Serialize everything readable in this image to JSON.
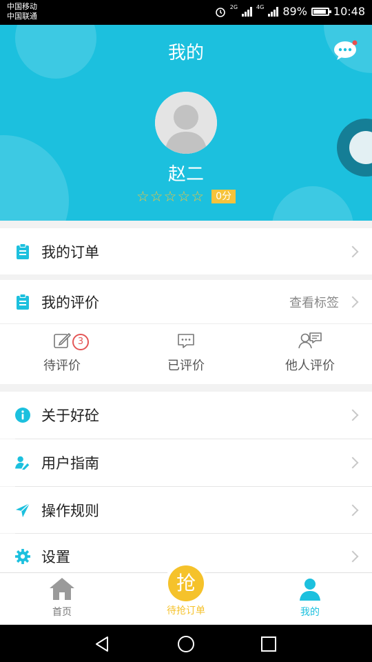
{
  "statusbar": {
    "carrier_1": "中国移动",
    "carrier_2": "中国联通",
    "net_1": "2G",
    "net_2": "4G",
    "battery_percent": "89%",
    "battery_level": 0.89,
    "time": "10:48"
  },
  "header": {
    "title": "我的",
    "user_name": "赵二",
    "rating_stars_total": 5,
    "rating_stars_filled": 0,
    "score_badge": "0分"
  },
  "menu": {
    "orders": "我的订单",
    "reviews": "我的评价",
    "reviews_right": "查看标签",
    "about": "关于好砼",
    "guide": "用户指南",
    "rules": "操作规则",
    "settings": "设置"
  },
  "review_tabs": {
    "pending": "待评价",
    "pending_count": "3",
    "done": "已评价",
    "others": "他人评价"
  },
  "tabbar": {
    "home": "首页",
    "grab_icon": "抢",
    "grab": "待抢订单",
    "mine": "我的"
  },
  "colors": {
    "primary": "#1cc0de",
    "accent": "#f5c33b",
    "badge": "#e45656"
  }
}
